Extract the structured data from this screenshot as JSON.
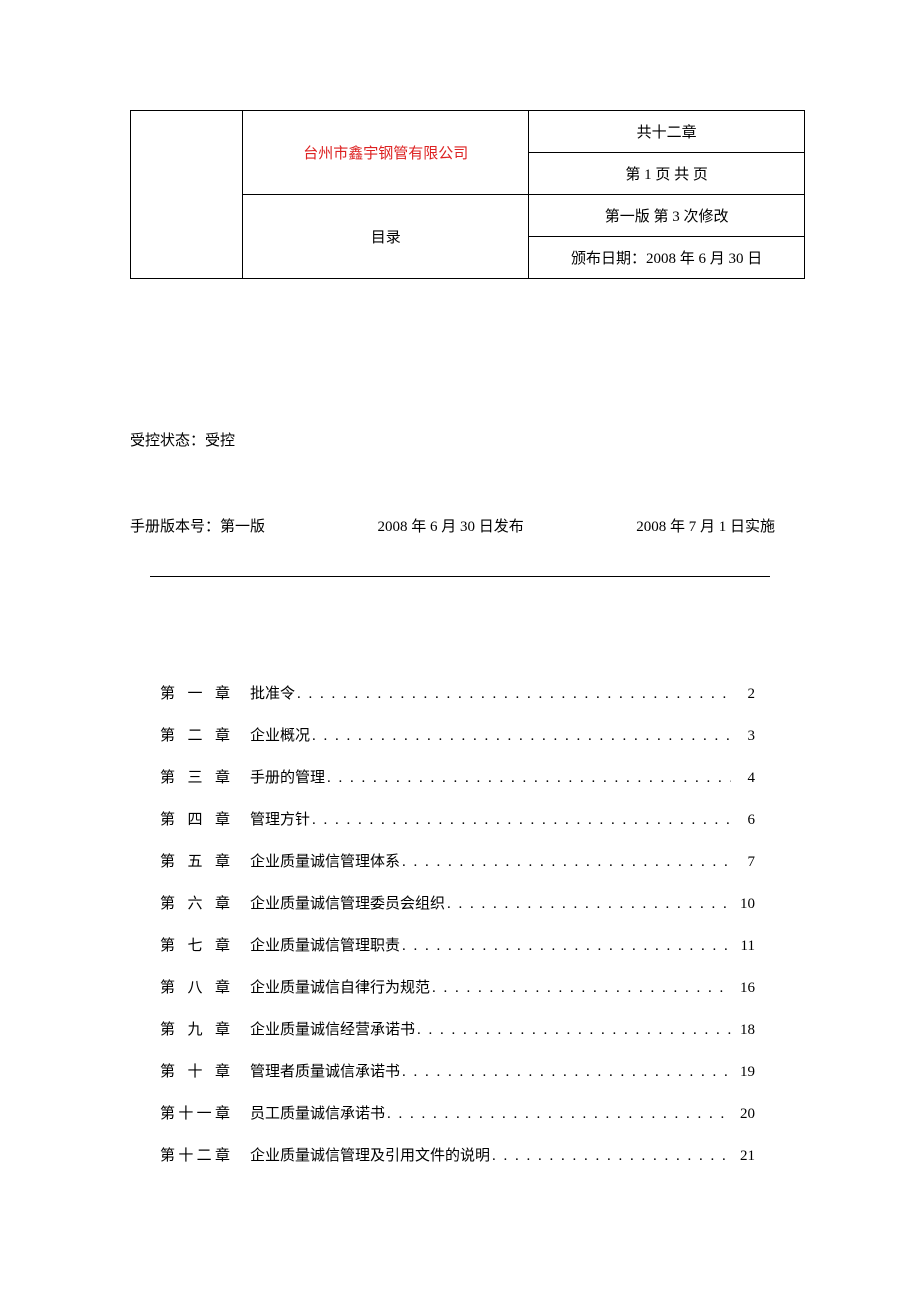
{
  "header": {
    "company": "台州市鑫宇钢管有限公司",
    "chapters_total": "共十二章",
    "page_info": "第 1 页  共  页",
    "toc_label": "目录",
    "version_revision": "第一版  第 3 次修改",
    "issue_date": "颁布日期：2008 年 6 月 30 日"
  },
  "control_status": "受控状态：受控",
  "version_line": {
    "manual_version": "手册版本号：第一版",
    "release_date": "2008 年 6 月 30 日发布",
    "effective_date": "2008 年 7 月 1 日实施"
  },
  "toc": [
    {
      "chapter": "第一章",
      "title": "批准令",
      "page": "2"
    },
    {
      "chapter": "第二章",
      "title": "企业概况",
      "page": "3"
    },
    {
      "chapter": "第三章",
      "title": "手册的管理",
      "page": "4"
    },
    {
      "chapter": "第四章",
      "title": "管理方针",
      "page": "6"
    },
    {
      "chapter": "第五章",
      "title": "企业质量诚信管理体系",
      "page": "7"
    },
    {
      "chapter": "第六章",
      "title": "企业质量诚信管理委员会组织",
      "page": "10"
    },
    {
      "chapter": "第七章",
      "title": "企业质量诚信管理职责",
      "page": "11"
    },
    {
      "chapter": "第八章",
      "title": "企业质量诚信自律行为规范",
      "page": "16"
    },
    {
      "chapter": "第九章",
      "title": "企业质量诚信经营承诺书",
      "page": "18"
    },
    {
      "chapter": "第十章",
      "title": "管理者质量诚信承诺书",
      "page": "19"
    },
    {
      "chapter": "第十一章",
      "title": "员工质量诚信承诺书",
      "page": "20"
    },
    {
      "chapter": "第十二章",
      "title": "企业质量诚信管理及引用文件的说明",
      "page": "21"
    }
  ]
}
